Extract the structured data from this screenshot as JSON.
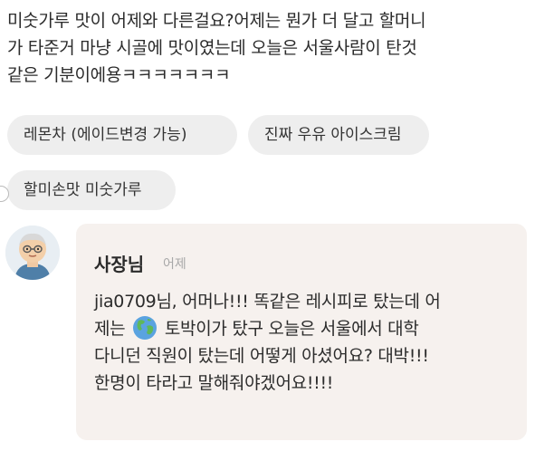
{
  "review": {
    "lines": [
      "미숫가루 맛이 어제와 다른걸요?어제는 뭔가 더 달고 할머니",
      "가 타준거 마냥 시골에 맛이였는데  오늘은 서울사람이 탄것",
      "같은 기분이에용ㅋㅋㅋㅋㅋㅋㅋ"
    ]
  },
  "menu_chips": [
    "레몬차 (에이드변경 가능)",
    "진짜 우유 아이스크림",
    "할미손맛 미숫가루"
  ],
  "owner_reply": {
    "name": "사장님",
    "time": "어제",
    "line1": "jia0709님, 어머나!!! 똑같은 레시피로 탔는데 어",
    "line2_before": "제는",
    "line2_after": "토박이가 탔구 오늘은 서울에서 대학",
    "line3": "다니던 직원이 탔는데 어떻게 아셨어요? 대박!!!",
    "line4": "한명이 타라고 말해줘야겠어요!!!!",
    "inline_icon": "globe-emoji-icon",
    "avatar_icon": "owner-avatar-icon"
  },
  "colors": {
    "chip_bg": "#eeeeee",
    "bubble_bg": "#f6f1ee",
    "timestamp": "#a8a8a8"
  }
}
